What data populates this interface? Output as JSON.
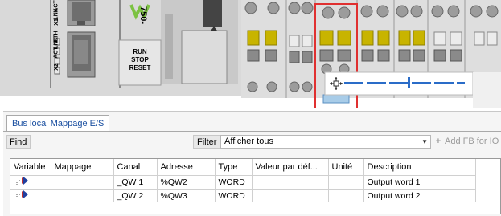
{
  "hardware": {
    "port_labels_left": [
      "X2",
      "X1"
    ],
    "port_labels_leds": [
      "ACT",
      "LNK",
      "ETH",
      "ACT",
      "LNK"
    ],
    "controller_model": "750-",
    "switch_labels": [
      "RUN",
      "STOP",
      "RESET"
    ],
    "selection_toolbar": {
      "move_icon": "move-icon"
    }
  },
  "panel": {
    "tab_label": "Bus local Mappage E/S",
    "find_label": "Find",
    "filter_label": "Filter",
    "filter_value": "Afficher tous",
    "add_fb_label": "Add FB for IO",
    "columns": [
      "Variable",
      "Mappage",
      "Canal",
      "Adresse",
      "Type",
      "Valeur par déf...",
      "Unité",
      "Description"
    ],
    "rows": [
      {
        "variable": "",
        "mappage": "",
        "canal": "_QW 1",
        "adresse": "%QW2",
        "type": "WORD",
        "default": "",
        "unite": "",
        "description": "Output word 1"
      },
      {
        "variable": "",
        "mappage": "",
        "canal": "_QW 2",
        "adresse": "%QW3",
        "type": "WORD",
        "default": "",
        "unite": "",
        "description": "Output word 2"
      }
    ]
  },
  "colors": {
    "terminal_yellow": "#c8b400",
    "selection_red": "#e03030",
    "tab_text": "#1a4fa0",
    "slider_blue": "#2a6cc8"
  }
}
